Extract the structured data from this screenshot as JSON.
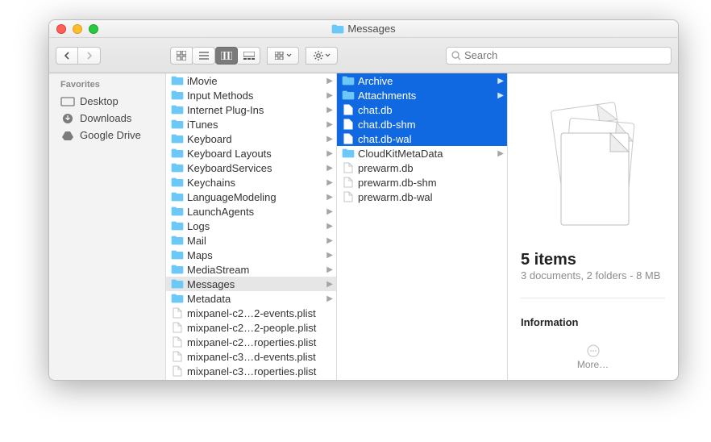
{
  "window": {
    "title": "Messages"
  },
  "toolbar": {
    "search_placeholder": "Search"
  },
  "sidebar": {
    "header": "Favorites",
    "items": [
      {
        "icon": "desktop-icon",
        "label": "Desktop"
      },
      {
        "icon": "downloads-icon",
        "label": "Downloads"
      },
      {
        "icon": "googledrive-icon",
        "label": "Google Drive"
      }
    ]
  },
  "col1": [
    {
      "type": "folder",
      "name": "iMovie",
      "hasChildren": true
    },
    {
      "type": "folder",
      "name": "Input Methods",
      "hasChildren": true
    },
    {
      "type": "folder",
      "name": "Internet Plug-Ins",
      "hasChildren": true
    },
    {
      "type": "folder",
      "name": "iTunes",
      "hasChildren": true
    },
    {
      "type": "folder",
      "name": "Keyboard",
      "hasChildren": true
    },
    {
      "type": "folder",
      "name": "Keyboard Layouts",
      "hasChildren": true
    },
    {
      "type": "folder",
      "name": "KeyboardServices",
      "hasChildren": true
    },
    {
      "type": "folder",
      "name": "Keychains",
      "hasChildren": true
    },
    {
      "type": "folder",
      "name": "LanguageModeling",
      "hasChildren": true
    },
    {
      "type": "folder",
      "name": "LaunchAgents",
      "hasChildren": true
    },
    {
      "type": "folder",
      "name": "Logs",
      "hasChildren": true
    },
    {
      "type": "folder",
      "name": "Mail",
      "hasChildren": true
    },
    {
      "type": "folder",
      "name": "Maps",
      "hasChildren": true
    },
    {
      "type": "folder",
      "name": "MediaStream",
      "hasChildren": true
    },
    {
      "type": "folder",
      "name": "Messages",
      "hasChildren": true,
      "selected": true
    },
    {
      "type": "folder",
      "name": "Metadata",
      "hasChildren": true
    },
    {
      "type": "file",
      "name": "mixpanel-c2…2-events.plist"
    },
    {
      "type": "file",
      "name": "mixpanel-c2…2-people.plist"
    },
    {
      "type": "file",
      "name": "mixpanel-c2…roperties.plist"
    },
    {
      "type": "file",
      "name": "mixpanel-c3…d-events.plist"
    },
    {
      "type": "file",
      "name": "mixpanel-c3…roperties.plist"
    }
  ],
  "col2": [
    {
      "type": "folder",
      "name": "Archive",
      "hasChildren": true,
      "highlighted": true
    },
    {
      "type": "folder",
      "name": "Attachments",
      "hasChildren": true,
      "highlighted": true
    },
    {
      "type": "file",
      "name": "chat.db",
      "highlighted": true
    },
    {
      "type": "file",
      "name": "chat.db-shm",
      "highlighted": true
    },
    {
      "type": "file",
      "name": "chat.db-wal",
      "highlighted": true
    },
    {
      "type": "folder",
      "name": "CloudKitMetaData",
      "hasChildren": true
    },
    {
      "type": "file",
      "name": "prewarm.db"
    },
    {
      "type": "file",
      "name": "prewarm.db-shm"
    },
    {
      "type": "file",
      "name": "prewarm.db-wal"
    }
  ],
  "preview": {
    "count_label": "5 items",
    "summary": "3 documents, 2 folders - 8 MB",
    "info_header": "Information",
    "more_label": "More…"
  }
}
